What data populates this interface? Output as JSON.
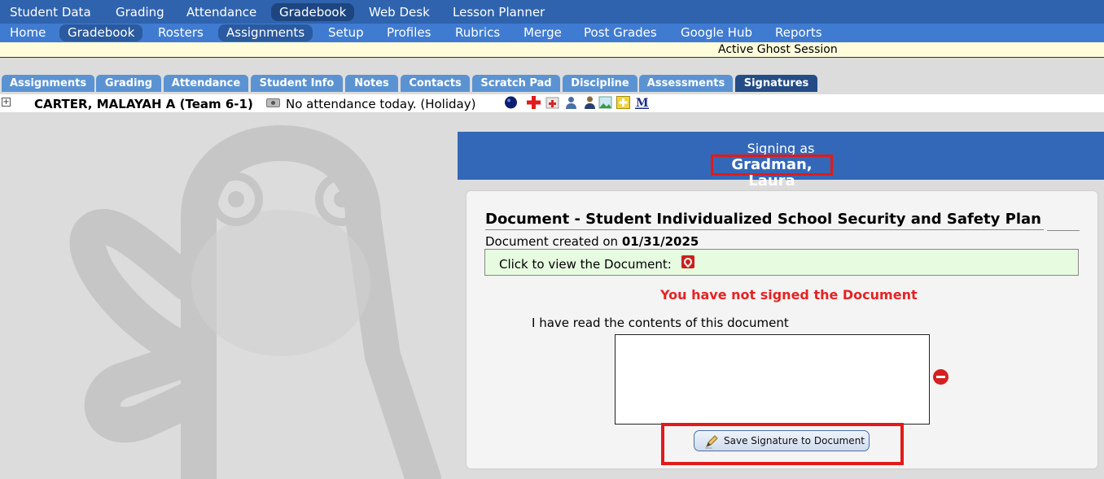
{
  "nav_primary": {
    "items": [
      "Student Data",
      "Grading",
      "Attendance",
      "Gradebook",
      "Web Desk",
      "Lesson Planner"
    ],
    "active": "Gradebook"
  },
  "nav_secondary": {
    "items": [
      "Home",
      "Gradebook",
      "Rosters",
      "Assignments",
      "Setup",
      "Profiles",
      "Rubrics",
      "Merge",
      "Post Grades",
      "Google Hub",
      "Reports"
    ],
    "active": [
      "Gradebook",
      "Assignments"
    ]
  },
  "banner": {
    "text": "Active Ghost Session"
  },
  "tabs": {
    "items": [
      "Assignments",
      "Grading",
      "Attendance",
      "Student Info",
      "Notes",
      "Contacts",
      "Scratch Pad",
      "Discipline",
      "Assessments",
      "Signatures"
    ],
    "active": "Signatures"
  },
  "student": {
    "expand_symbol": "+",
    "name": "CARTER, MALAYAH A (Team 6-1)",
    "attendance_note": "No attendance today. (Holiday)",
    "status_icons": [
      "circle-icon",
      "medical-cross-icon",
      "health-icon",
      "person-icon",
      "counselor-icon",
      "image-icon",
      "plus-star-icon",
      "m-icon"
    ]
  },
  "signing": {
    "label": "Signing as",
    "signer": "Gradman, Laura"
  },
  "document": {
    "title": "Document - Student Individualized School Security and Safety Plan",
    "created_prefix": "Document created on",
    "created_date": "01/31/2025",
    "view_label": "Click to view the Document:",
    "status": "You have not signed the Document",
    "acknowledge": "I have read the contents of this document",
    "save_button": "Save Signature to Document"
  },
  "colors": {
    "nav_primary": "#2f63ad",
    "nav_secondary": "#3f7bd1",
    "tab": "#5b93d2",
    "tab_active": "#244c86",
    "signing_header": "#3368b9",
    "status_red": "#e82222",
    "highlight_red": "#e21a1a",
    "view_box_green": "#e6fbe0"
  }
}
